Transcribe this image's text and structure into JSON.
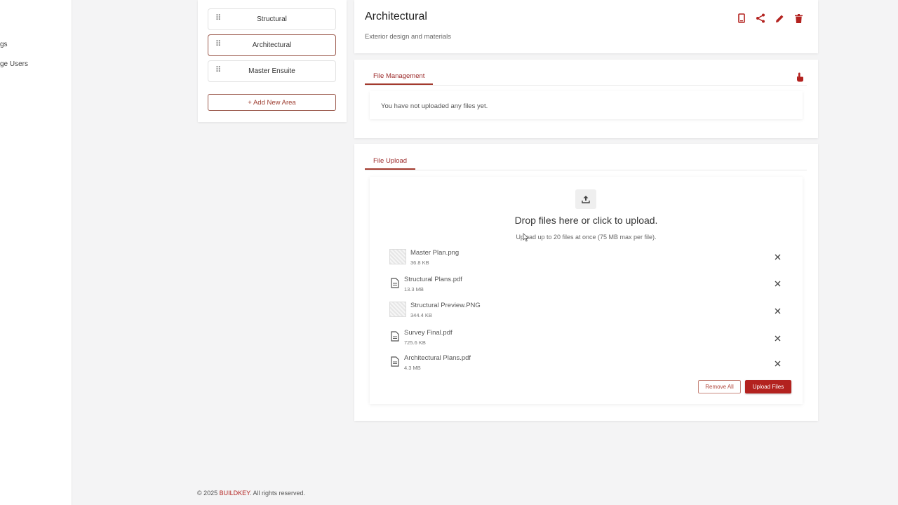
{
  "sidebar": {
    "items": [
      {
        "label": "gs"
      },
      {
        "label": "ge Users"
      }
    ]
  },
  "areas": {
    "items": [
      {
        "label": "Structural"
      },
      {
        "label": "Architectural"
      },
      {
        "label": "Master Ensuite"
      }
    ],
    "add_label": "+ Add New Area"
  },
  "header": {
    "title": "Architectural",
    "subtitle": "Exterior design and materials",
    "actions": [
      "device-icon",
      "share-icon",
      "edit-icon",
      "delete-icon"
    ]
  },
  "file_management": {
    "tab_label": "File Management",
    "empty_text": "You have not uploaded any files yet."
  },
  "file_upload": {
    "tab_label": "File Upload",
    "drop_title": "Drop files here or click to upload.",
    "drop_subtitle": "Upload up to 20 files at once (75 MB max per file).",
    "files": [
      {
        "name": "Master Plan.png",
        "size": "36.8 KB",
        "type": "image"
      },
      {
        "name": "Structural Plans.pdf",
        "size": "13.3 MB",
        "type": "document"
      },
      {
        "name": "Structural Preview.PNG",
        "size": "344.4 KB",
        "type": "image"
      },
      {
        "name": "Survey Final.pdf",
        "size": "725.6 KB",
        "type": "document"
      },
      {
        "name": "Architectural Plans.pdf",
        "size": "4.3 MB",
        "type": "document"
      }
    ],
    "remove_all_label": "Remove All",
    "upload_label": "Upload Files"
  },
  "footer": {
    "prefix": "© 2025 ",
    "brand": "BUILDKEY",
    "suffix": ". All rights reserved."
  },
  "colors": {
    "accent": "#b3221f",
    "accent_border": "#9c5b4e"
  }
}
